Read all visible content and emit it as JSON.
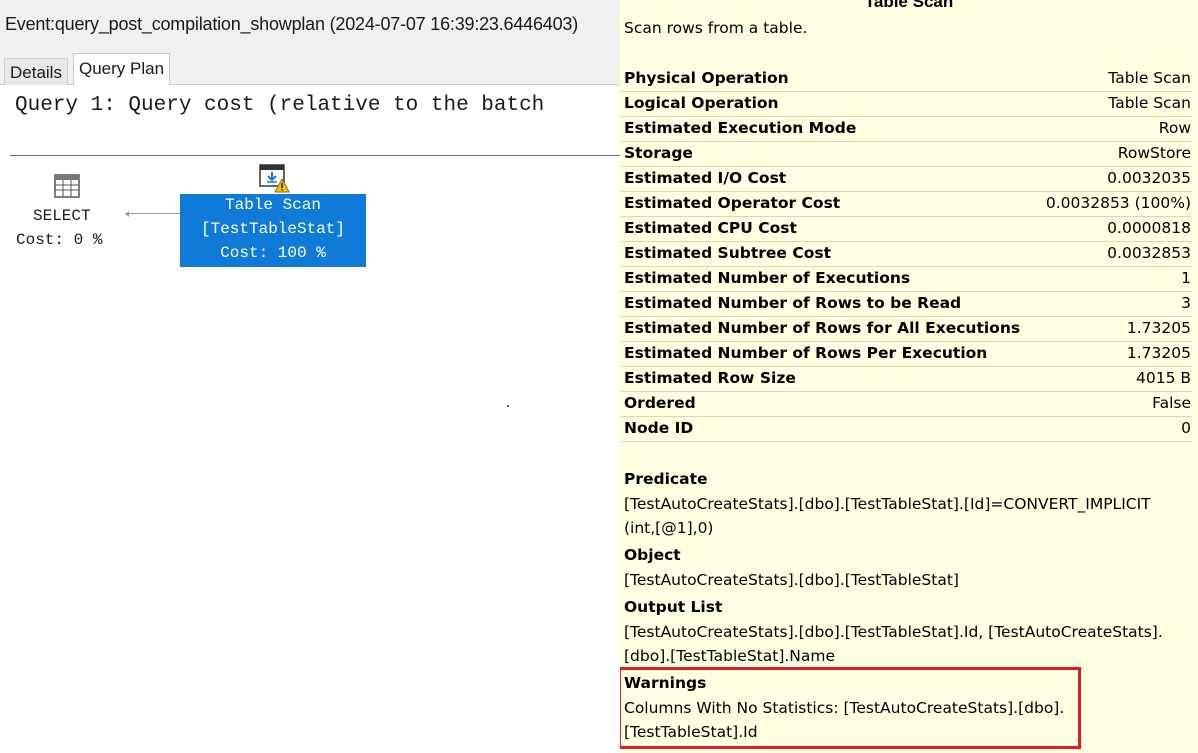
{
  "event": {
    "title": "Event:query_post_compilation_showplan (2024-07-07 16:39:23.6446403)"
  },
  "tabs": [
    {
      "label": "Details"
    },
    {
      "label": "Query Plan"
    }
  ],
  "plan": {
    "query_text": "Query 1: Query cost (relative to the batch",
    "select_node": {
      "label": "SELECT",
      "cost": "Cost: 0 %"
    },
    "scan_node": {
      "line1": "Table Scan",
      "line2": "[TestTableStat]",
      "line3": "Cost: 100 %"
    },
    "icons": {
      "select": "select-table-icon",
      "scan": "table-scan-icon",
      "warning": "warning-triangle-icon"
    }
  },
  "tooltip": {
    "title": "Table Scan",
    "description": "Scan rows from a table.",
    "properties": [
      {
        "name": "Physical Operation",
        "value": "Table Scan"
      },
      {
        "name": "Logical Operation",
        "value": "Table Scan"
      },
      {
        "name": "Estimated Execution Mode",
        "value": "Row"
      },
      {
        "name": "Storage",
        "value": "RowStore"
      },
      {
        "name": "Estimated I/O Cost",
        "value": "0.0032035"
      },
      {
        "name": "Estimated Operator Cost",
        "value": "0.0032853 (100%)"
      },
      {
        "name": "Estimated CPU Cost",
        "value": "0.0000818"
      },
      {
        "name": "Estimated Subtree Cost",
        "value": "0.0032853"
      },
      {
        "name": "Estimated Number of Executions",
        "value": "1"
      },
      {
        "name": "Estimated Number of Rows to be Read",
        "value": "3"
      },
      {
        "name": "Estimated Number of Rows for All Executions",
        "value": "1.73205"
      },
      {
        "name": "Estimated Number of Rows Per Execution",
        "value": "1.73205"
      },
      {
        "name": "Estimated Row Size",
        "value": "4015 B"
      },
      {
        "name": "Ordered",
        "value": "False"
      },
      {
        "name": "Node ID",
        "value": "0"
      }
    ],
    "predicate": {
      "heading": "Predicate",
      "line1": "[TestAutoCreateStats].[dbo].[TestTableStat].[Id]=CONVERT_IMPLICIT",
      "line2": "(int,[@1],0)"
    },
    "object": {
      "heading": "Object",
      "line1": "[TestAutoCreateStats].[dbo].[TestTableStat]"
    },
    "output_list": {
      "heading": "Output List",
      "line1": "[TestAutoCreateStats].[dbo].[TestTableStat].Id,  [TestAutoCreateStats].",
      "line2": "[dbo].[TestTableStat].Name"
    },
    "warnings": {
      "heading": "Warnings",
      "line1": "Columns With No Statistics: [TestAutoCreateStats].[dbo].",
      "line2": "[TestTableStat].Id",
      "highlight_color": "#e01b24"
    }
  },
  "colors": {
    "node_fill": "#0f7ad8",
    "tooltip_bg": "#ffffe1"
  }
}
